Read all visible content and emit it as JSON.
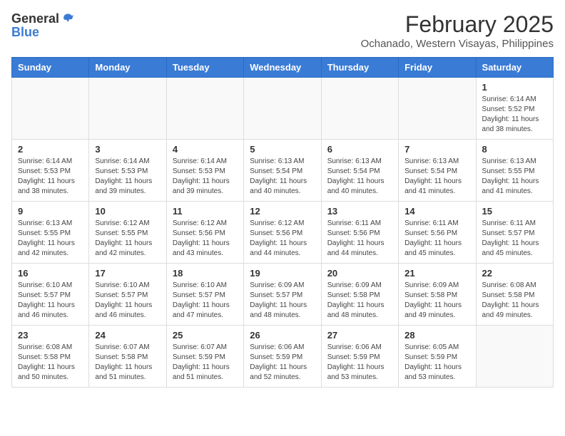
{
  "logo": {
    "general": "General",
    "blue": "Blue"
  },
  "title": "February 2025",
  "subtitle": "Ochanado, Western Visayas, Philippines",
  "headers": [
    "Sunday",
    "Monday",
    "Tuesday",
    "Wednesday",
    "Thursday",
    "Friday",
    "Saturday"
  ],
  "weeks": [
    [
      {
        "day": "",
        "info": ""
      },
      {
        "day": "",
        "info": ""
      },
      {
        "day": "",
        "info": ""
      },
      {
        "day": "",
        "info": ""
      },
      {
        "day": "",
        "info": ""
      },
      {
        "day": "",
        "info": ""
      },
      {
        "day": "1",
        "info": "Sunrise: 6:14 AM\nSunset: 5:52 PM\nDaylight: 11 hours\nand 38 minutes."
      }
    ],
    [
      {
        "day": "2",
        "info": "Sunrise: 6:14 AM\nSunset: 5:53 PM\nDaylight: 11 hours\nand 38 minutes."
      },
      {
        "day": "3",
        "info": "Sunrise: 6:14 AM\nSunset: 5:53 PM\nDaylight: 11 hours\nand 39 minutes."
      },
      {
        "day": "4",
        "info": "Sunrise: 6:14 AM\nSunset: 5:53 PM\nDaylight: 11 hours\nand 39 minutes."
      },
      {
        "day": "5",
        "info": "Sunrise: 6:13 AM\nSunset: 5:54 PM\nDaylight: 11 hours\nand 40 minutes."
      },
      {
        "day": "6",
        "info": "Sunrise: 6:13 AM\nSunset: 5:54 PM\nDaylight: 11 hours\nand 40 minutes."
      },
      {
        "day": "7",
        "info": "Sunrise: 6:13 AM\nSunset: 5:54 PM\nDaylight: 11 hours\nand 41 minutes."
      },
      {
        "day": "8",
        "info": "Sunrise: 6:13 AM\nSunset: 5:55 PM\nDaylight: 11 hours\nand 41 minutes."
      }
    ],
    [
      {
        "day": "9",
        "info": "Sunrise: 6:13 AM\nSunset: 5:55 PM\nDaylight: 11 hours\nand 42 minutes."
      },
      {
        "day": "10",
        "info": "Sunrise: 6:12 AM\nSunset: 5:55 PM\nDaylight: 11 hours\nand 42 minutes."
      },
      {
        "day": "11",
        "info": "Sunrise: 6:12 AM\nSunset: 5:56 PM\nDaylight: 11 hours\nand 43 minutes."
      },
      {
        "day": "12",
        "info": "Sunrise: 6:12 AM\nSunset: 5:56 PM\nDaylight: 11 hours\nand 44 minutes."
      },
      {
        "day": "13",
        "info": "Sunrise: 6:11 AM\nSunset: 5:56 PM\nDaylight: 11 hours\nand 44 minutes."
      },
      {
        "day": "14",
        "info": "Sunrise: 6:11 AM\nSunset: 5:56 PM\nDaylight: 11 hours\nand 45 minutes."
      },
      {
        "day": "15",
        "info": "Sunrise: 6:11 AM\nSunset: 5:57 PM\nDaylight: 11 hours\nand 45 minutes."
      }
    ],
    [
      {
        "day": "16",
        "info": "Sunrise: 6:10 AM\nSunset: 5:57 PM\nDaylight: 11 hours\nand 46 minutes."
      },
      {
        "day": "17",
        "info": "Sunrise: 6:10 AM\nSunset: 5:57 PM\nDaylight: 11 hours\nand 46 minutes."
      },
      {
        "day": "18",
        "info": "Sunrise: 6:10 AM\nSunset: 5:57 PM\nDaylight: 11 hours\nand 47 minutes."
      },
      {
        "day": "19",
        "info": "Sunrise: 6:09 AM\nSunset: 5:57 PM\nDaylight: 11 hours\nand 48 minutes."
      },
      {
        "day": "20",
        "info": "Sunrise: 6:09 AM\nSunset: 5:58 PM\nDaylight: 11 hours\nand 48 minutes."
      },
      {
        "day": "21",
        "info": "Sunrise: 6:09 AM\nSunset: 5:58 PM\nDaylight: 11 hours\nand 49 minutes."
      },
      {
        "day": "22",
        "info": "Sunrise: 6:08 AM\nSunset: 5:58 PM\nDaylight: 11 hours\nand 49 minutes."
      }
    ],
    [
      {
        "day": "23",
        "info": "Sunrise: 6:08 AM\nSunset: 5:58 PM\nDaylight: 11 hours\nand 50 minutes."
      },
      {
        "day": "24",
        "info": "Sunrise: 6:07 AM\nSunset: 5:58 PM\nDaylight: 11 hours\nand 51 minutes."
      },
      {
        "day": "25",
        "info": "Sunrise: 6:07 AM\nSunset: 5:59 PM\nDaylight: 11 hours\nand 51 minutes."
      },
      {
        "day": "26",
        "info": "Sunrise: 6:06 AM\nSunset: 5:59 PM\nDaylight: 11 hours\nand 52 minutes."
      },
      {
        "day": "27",
        "info": "Sunrise: 6:06 AM\nSunset: 5:59 PM\nDaylight: 11 hours\nand 53 minutes."
      },
      {
        "day": "28",
        "info": "Sunrise: 6:05 AM\nSunset: 5:59 PM\nDaylight: 11 hours\nand 53 minutes."
      },
      {
        "day": "",
        "info": ""
      }
    ]
  ]
}
